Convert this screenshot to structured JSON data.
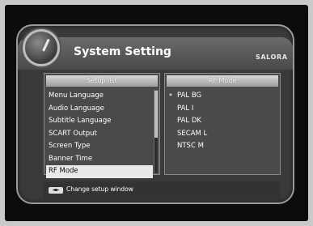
{
  "header": {
    "title": "System Setting",
    "brand": "SALORA"
  },
  "left_panel": {
    "heading": "Setup list",
    "items": [
      {
        "label": "Menu Language",
        "selected": false
      },
      {
        "label": "Audio Language",
        "selected": false
      },
      {
        "label": "Subtitle Language",
        "selected": false
      },
      {
        "label": "SCART Output",
        "selected": false
      },
      {
        "label": "Screen Type",
        "selected": false
      },
      {
        "label": "Banner Time",
        "selected": false
      },
      {
        "label": "RF Mode",
        "selected": true
      }
    ]
  },
  "right_panel": {
    "heading": "RF Mode",
    "options": [
      {
        "label": "PAL BG",
        "current": true,
        "marker": "*"
      },
      {
        "label": "PAL I",
        "current": false
      },
      {
        "label": "PAL DK",
        "current": false
      },
      {
        "label": "SECAM L",
        "current": false
      },
      {
        "label": "NTSC M",
        "current": false
      }
    ]
  },
  "footer": {
    "key_glyph": "◄►",
    "hint": "Change setup window"
  },
  "colors": {
    "window_bg": "#3a3a3a",
    "panel_bg": "#4a4a4a",
    "highlight": "#e8e8e8"
  }
}
